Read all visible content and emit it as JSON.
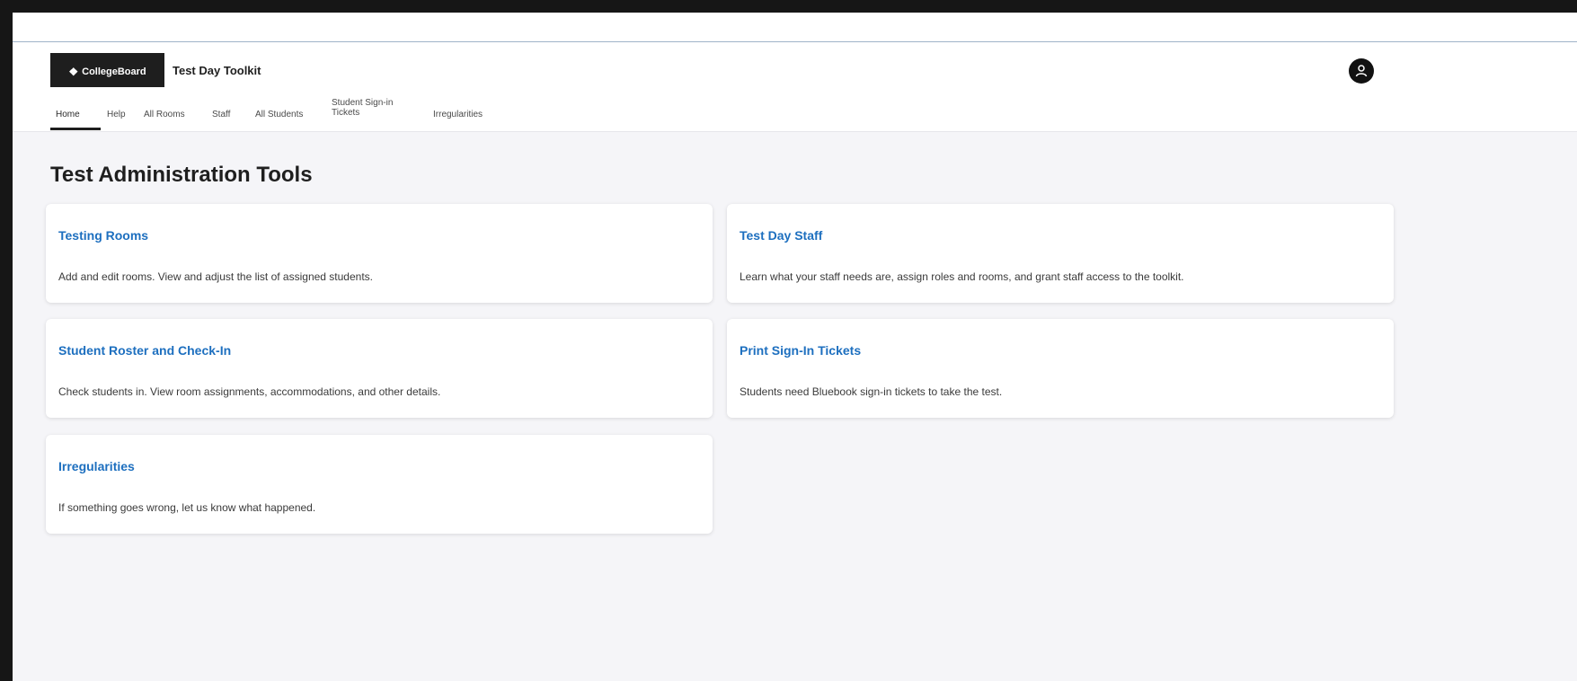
{
  "header": {
    "brand": "CollegeBoard",
    "app_title": "Test Day Toolkit"
  },
  "nav": {
    "items": [
      {
        "label": "Home"
      },
      {
        "label": "Help"
      },
      {
        "label": "All Rooms"
      },
      {
        "label": "Staff"
      },
      {
        "label": "All Students"
      },
      {
        "label": "Student Sign-in\nTickets"
      },
      {
        "label": "Irregularities"
      }
    ],
    "active": "Home"
  },
  "main": {
    "title": "Test Administration Tools",
    "cards": [
      {
        "title": "Testing Rooms",
        "description": "Add and edit rooms. View and adjust the list of assigned students."
      },
      {
        "title": "Test Day Staff",
        "description": "Learn what your staff needs are, assign roles and rooms, and grant staff access to the toolkit."
      },
      {
        "title": "Student Roster and Check-In",
        "description": "Check students in. View room assignments, accommodations, and other details."
      },
      {
        "title": "Print Sign-In Tickets",
        "description": "Students need Bluebook sign-in tickets to take the test."
      },
      {
        "title": "Irregularities",
        "description": "If something goes wrong, let us know what happened."
      }
    ]
  },
  "colors": {
    "link": "#1d6fbf",
    "header_bg": "#1e1e1e",
    "page_bg": "#f5f5f8"
  },
  "icons": {
    "avatar": "user-avatar-icon"
  }
}
